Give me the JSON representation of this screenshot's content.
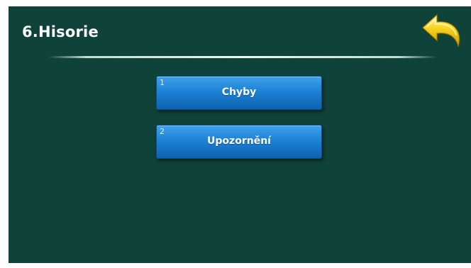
{
  "header": {
    "title": "6.Hisorie",
    "back_icon": "back-arrow-icon"
  },
  "menu": {
    "items": [
      {
        "number": "1",
        "label": "Chyby"
      },
      {
        "number": "2",
        "label": "Upozornění"
      }
    ]
  },
  "colors": {
    "background": "#0f4238",
    "button": "#1e82d6",
    "back_arrow": "#f5d020",
    "text": "#ffffff"
  }
}
